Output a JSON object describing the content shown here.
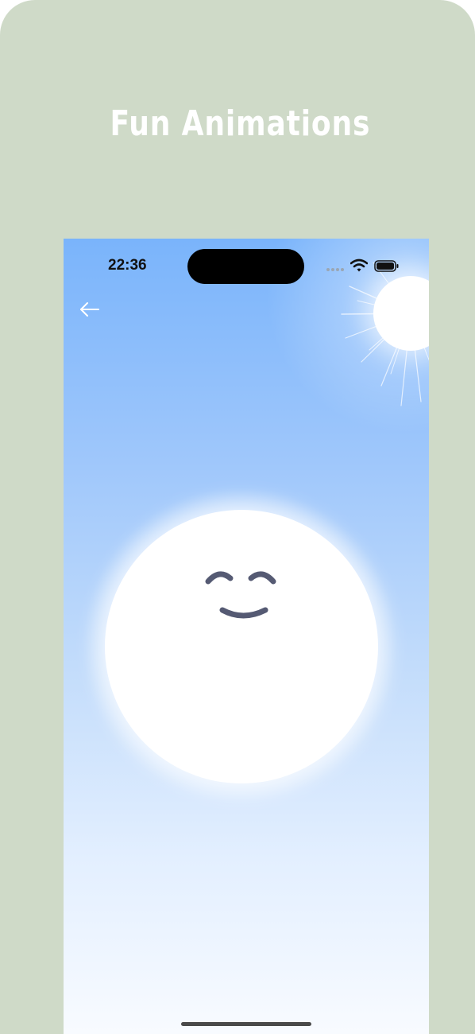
{
  "headline": "Fun Animations",
  "status_bar": {
    "time": "22:36",
    "signal_icon": "cellular-signal-icon",
    "wifi_icon": "wifi-icon",
    "battery_icon": "battery-icon"
  },
  "navigation": {
    "back_icon": "arrow-left-icon"
  },
  "scene": {
    "sun_icon": "sun-icon",
    "character_icon": "smiling-cloud-face-icon"
  },
  "colors": {
    "frame_background": "#cfdac8",
    "sky_top": "#7ab4fb",
    "sky_bottom": "#f8fbff",
    "face_features": "#555a73",
    "headline_text": "#ffffff"
  }
}
